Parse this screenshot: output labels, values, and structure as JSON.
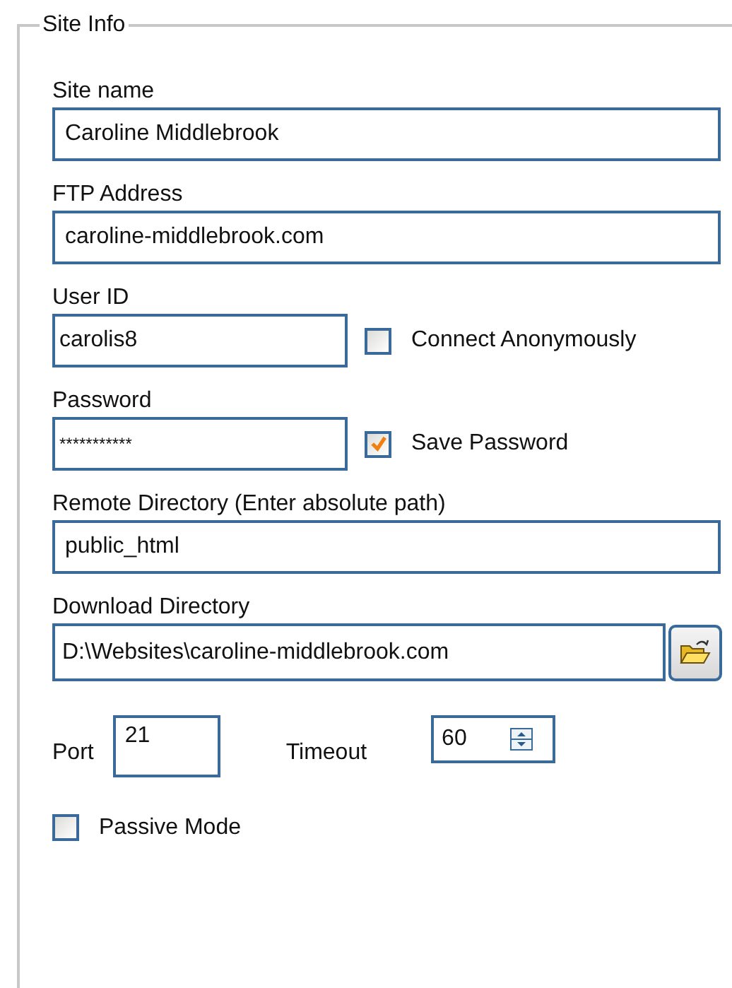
{
  "group_box": {
    "title": "Site Info"
  },
  "site_name": {
    "label": "Site name",
    "value": "Caroline Middlebrook"
  },
  "ftp_address": {
    "label": "FTP Address",
    "value": "caroline-middlebrook.com"
  },
  "user_id": {
    "label": "User ID",
    "value": "carolis8",
    "checkbox": {
      "label": "Connect Anonymously",
      "checked": false
    }
  },
  "password": {
    "label": "Password",
    "value": "***********",
    "checkbox": {
      "label": "Save Password",
      "checked": true
    }
  },
  "remote_directory": {
    "label": "Remote Directory (Enter absolute path)",
    "value": "public_html"
  },
  "download_directory": {
    "label": "Download Directory",
    "value": "D:\\Websites\\caroline-middlebrook.com"
  },
  "port": {
    "label": "Port",
    "value": "21"
  },
  "timeout": {
    "label": "Timeout",
    "value": "60"
  },
  "passive_mode": {
    "label": "Passive Mode",
    "checked": false
  }
}
